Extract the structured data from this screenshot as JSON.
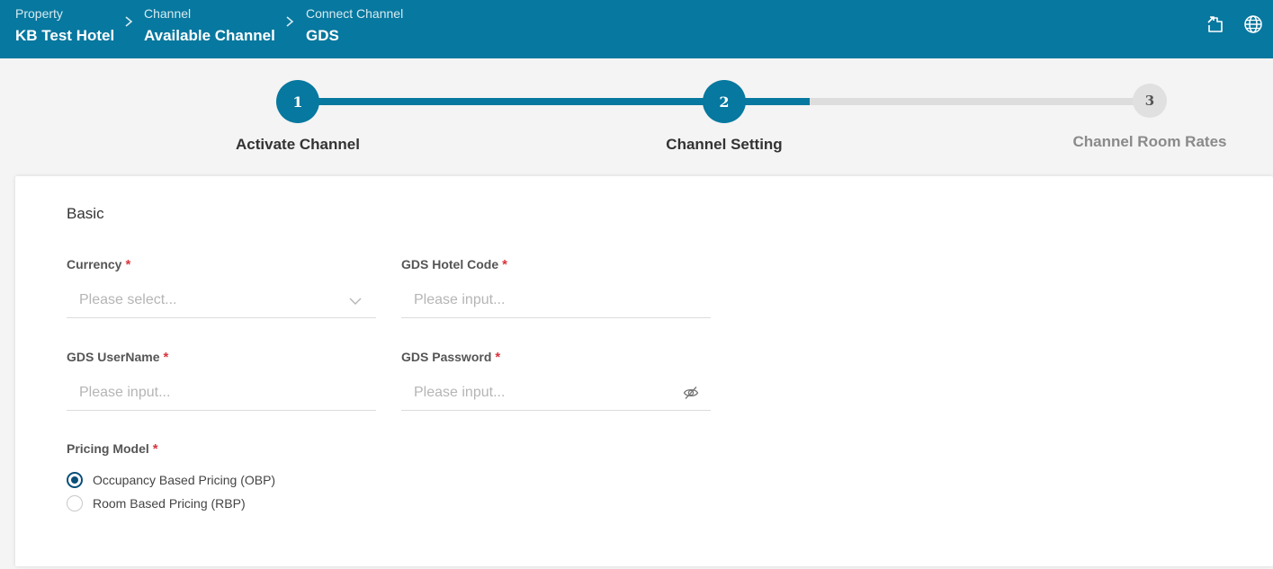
{
  "breadcrumb": [
    {
      "small": "Property",
      "big": "KB Test Hotel"
    },
    {
      "small": "Channel",
      "big": "Available Channel"
    },
    {
      "small": "Connect Channel",
      "big": "GDS"
    }
  ],
  "header_icons": [
    "export-icon",
    "globe-icon"
  ],
  "stepper": {
    "steps": [
      {
        "number": "1",
        "label": "Activate Channel",
        "state": "done"
      },
      {
        "number": "2",
        "label": "Channel Setting",
        "state": "active"
      },
      {
        "number": "3",
        "label": "Channel Room Rates",
        "state": "pending"
      }
    ],
    "colors": {
      "active": "#07789f",
      "inactive": "#dddddd"
    }
  },
  "form": {
    "section_title": "Basic",
    "required_mark": "*",
    "currency": {
      "label": "Currency",
      "placeholder": "Please select...",
      "value": ""
    },
    "hotel_code": {
      "label": "GDS Hotel Code",
      "placeholder": "Please input...",
      "value": ""
    },
    "username": {
      "label": "GDS UserName",
      "placeholder": "Please input...",
      "value": ""
    },
    "password": {
      "label": "GDS Password",
      "placeholder": "Please input...",
      "value": ""
    },
    "pricing_model": {
      "label": "Pricing Model",
      "options": [
        {
          "label": "Occupancy Based Pricing (OBP)",
          "checked": true
        },
        {
          "label": "Room Based Pricing (RBP)",
          "checked": false
        }
      ]
    }
  }
}
